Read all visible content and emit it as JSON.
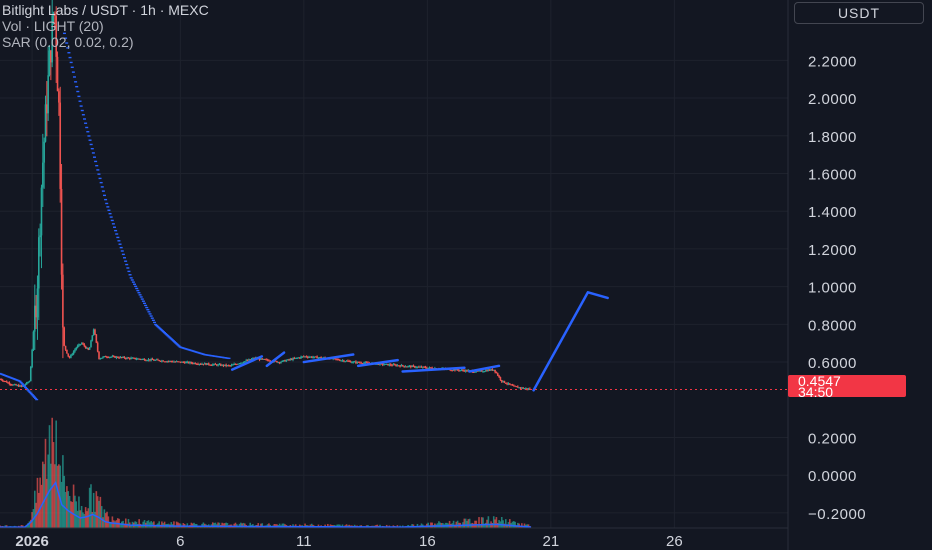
{
  "legend": {
    "title": "Bitlight Labs / USDT · 1h · MEXC",
    "volume": "Vol · LIGHT (20)",
    "sar": "SAR (0.02, 0.02, 0.2)"
  },
  "quote_button": "USDT",
  "last_price": {
    "value": "0.4547",
    "countdown": "34:50"
  },
  "colors": {
    "background": "#131722",
    "grid": "#1e222d",
    "up": "#26a69a",
    "down": "#ef5350",
    "drawing": "#2962ff",
    "last_price": "#f23645"
  },
  "chart_data": {
    "type": "candlestick",
    "title": "Bitlight Labs / USDT · 1h · MEXC",
    "price_axis": {
      "ticks": [
        "2.2000",
        "2.0000",
        "1.8000",
        "1.6000",
        "1.4000",
        "1.2000",
        "1.0000",
        "0.8000",
        "0.6000",
        "0.2000",
        "0.0000",
        "−0.2000"
      ],
      "tick_values": [
        2.2,
        2.0,
        1.8,
        1.6,
        1.4,
        1.2,
        1.0,
        0.8,
        0.6,
        0.2,
        0.0,
        -0.2
      ],
      "range": [
        -0.28,
        2.52
      ]
    },
    "time_axis": {
      "labels": [
        "2026",
        "6",
        "11",
        "16",
        "21",
        "26"
      ],
      "label_days": [
        0,
        6,
        11,
        16,
        21,
        26
      ],
      "range_days": [
        -1.3,
        30.6
      ]
    },
    "last_price": 0.4547,
    "price_series": [
      [
        -1.3,
        0.51
      ],
      [
        -0.8,
        0.48
      ],
      [
        -0.4,
        0.47
      ],
      [
        -0.1,
        0.5
      ],
      [
        0.2,
        1.0
      ],
      [
        0.4,
        1.6
      ],
      [
        0.6,
        2.0
      ],
      [
        0.8,
        2.35
      ],
      [
        0.9,
        2.5
      ],
      [
        1.1,
        1.9
      ],
      [
        1.25,
        0.7
      ],
      [
        1.5,
        0.62
      ],
      [
        1.8,
        0.68
      ],
      [
        2.0,
        0.7
      ],
      [
        2.3,
        0.66
      ],
      [
        2.5,
        0.78
      ],
      [
        2.7,
        0.62
      ],
      [
        3.0,
        0.63
      ],
      [
        4,
        0.62
      ],
      [
        5,
        0.61
      ],
      [
        6,
        0.6
      ],
      [
        7,
        0.59
      ],
      [
        8,
        0.58
      ],
      [
        9,
        0.62
      ],
      [
        10,
        0.6
      ],
      [
        11,
        0.63
      ],
      [
        12,
        0.62
      ],
      [
        13,
        0.6
      ],
      [
        14,
        0.59
      ],
      [
        15,
        0.58
      ],
      [
        16,
        0.57
      ],
      [
        17,
        0.56
      ],
      [
        18,
        0.55
      ],
      [
        18.7,
        0.56
      ],
      [
        19.0,
        0.5
      ],
      [
        19.5,
        0.47
      ],
      [
        20.2,
        0.4547
      ]
    ],
    "sar_series": [
      [
        -1.3,
        0.54
      ],
      [
        -0.5,
        0.5
      ],
      [
        0.2,
        0.4
      ],
      [
        1.3,
        2.35
      ],
      [
        2,
        1.95
      ],
      [
        3,
        1.45
      ],
      [
        4,
        1.05
      ],
      [
        5,
        0.8
      ],
      [
        6,
        0.68
      ],
      [
        7,
        0.64
      ],
      [
        8,
        0.62
      ]
    ],
    "volume_series": [
      [
        -0.2,
        0.02
      ],
      [
        0.2,
        0.3
      ],
      [
        0.5,
        0.6
      ],
      [
        0.8,
        0.9
      ],
      [
        1.0,
        1.0
      ],
      [
        1.2,
        0.5
      ],
      [
        1.5,
        0.35
      ],
      [
        2,
        0.2
      ],
      [
        2.5,
        0.3
      ],
      [
        3,
        0.12
      ],
      [
        4,
        0.06
      ],
      [
        6,
        0.04
      ],
      [
        10,
        0.03
      ],
      [
        15,
        0.02
      ],
      [
        18.8,
        0.08
      ],
      [
        20.2,
        0.02
      ]
    ],
    "annotations": {
      "trendline_segments": [
        [
          [
            8.1,
            0.56
          ],
          [
            9.3,
            0.63
          ]
        ],
        [
          [
            9.5,
            0.58
          ],
          [
            10.2,
            0.65
          ]
        ],
        [
          [
            11.0,
            0.6
          ],
          [
            13.0,
            0.64
          ]
        ],
        [
          [
            13.2,
            0.58
          ],
          [
            14.8,
            0.61
          ]
        ],
        [
          [
            15.0,
            0.55
          ],
          [
            17.5,
            0.57
          ]
        ],
        [
          [
            17.7,
            0.55
          ],
          [
            18.9,
            0.58
          ]
        ]
      ],
      "arrow": [
        [
          20.3,
          0.45
        ],
        [
          22.5,
          0.97
        ],
        [
          23.3,
          0.94
        ]
      ]
    }
  }
}
